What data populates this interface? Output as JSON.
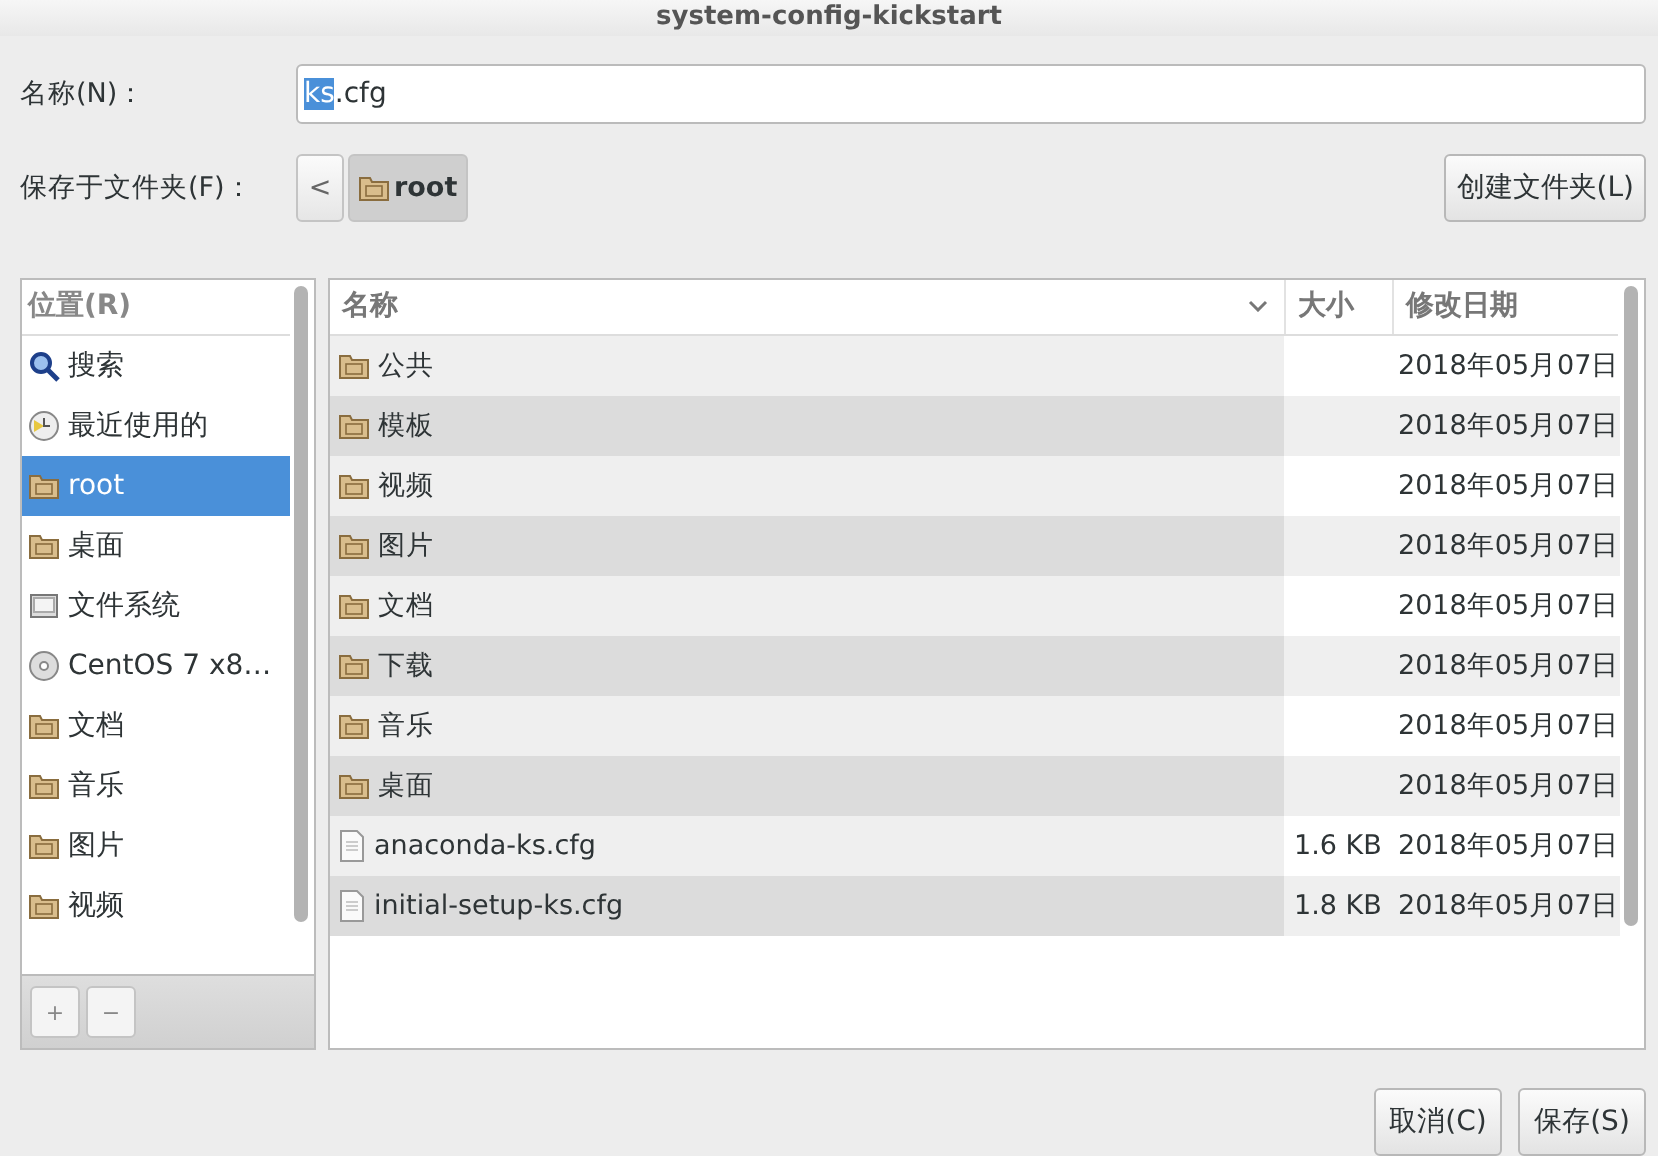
{
  "window": {
    "title": "system-config-kickstart"
  },
  "name_field": {
    "label": "名称(N)：",
    "selected_part": "ks",
    "rest": ".cfg"
  },
  "folder_row": {
    "label": "保存于文件夹(F)：",
    "back": "<",
    "path": [
      {
        "label": "root",
        "selected": true
      }
    ],
    "create_button": "创建文件夹(L)"
  },
  "places": {
    "header": "位置(R)",
    "items": [
      {
        "label": "搜索",
        "kind": "search",
        "selected": false
      },
      {
        "label": "最近使用的",
        "kind": "recent",
        "selected": false
      },
      {
        "label": "root",
        "kind": "folder",
        "selected": true
      },
      {
        "label": "桌面",
        "kind": "folder",
        "selected": false
      },
      {
        "label": "文件系统",
        "kind": "drive",
        "selected": false
      },
      {
        "label": "CentOS 7 x8…",
        "kind": "disc",
        "selected": false
      },
      {
        "label": "文档",
        "kind": "folder",
        "selected": false
      },
      {
        "label": "音乐",
        "kind": "folder",
        "selected": false
      },
      {
        "label": "图片",
        "kind": "folder",
        "selected": false
      },
      {
        "label": "视频",
        "kind": "folder",
        "selected": false
      }
    ],
    "add": "+",
    "remove": "−"
  },
  "files": {
    "columns": [
      "名称",
      "大小",
      "修改日期"
    ],
    "rows": [
      {
        "name": "公共",
        "kind": "folder",
        "size": "",
        "date": "2018年05月07日"
      },
      {
        "name": "模板",
        "kind": "folder",
        "size": "",
        "date": "2018年05月07日"
      },
      {
        "name": "视频",
        "kind": "folder",
        "size": "",
        "date": "2018年05月07日"
      },
      {
        "name": "图片",
        "kind": "folder",
        "size": "",
        "date": "2018年05月07日"
      },
      {
        "name": "文档",
        "kind": "folder",
        "size": "",
        "date": "2018年05月07日"
      },
      {
        "name": "下载",
        "kind": "folder",
        "size": "",
        "date": "2018年05月07日"
      },
      {
        "name": "音乐",
        "kind": "folder",
        "size": "",
        "date": "2018年05月07日"
      },
      {
        "name": "桌面",
        "kind": "folder",
        "size": "",
        "date": "2018年05月07日"
      },
      {
        "name": "anaconda-ks.cfg",
        "kind": "file",
        "size": "1.6 KB",
        "date": "2018年05月07日"
      },
      {
        "name": "initial-setup-ks.cfg",
        "kind": "file",
        "size": "1.8 KB",
        "date": "2018年05月07日"
      }
    ]
  },
  "buttons": [
    "取消(C)",
    "保存(S)"
  ]
}
